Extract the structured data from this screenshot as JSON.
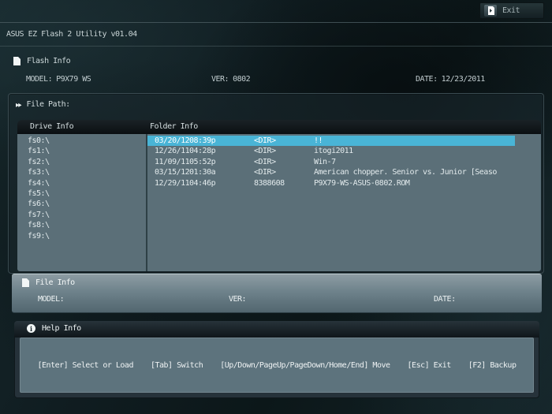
{
  "app": {
    "title": "ASUS EZ Flash 2 Utility v01.04",
    "exit_label": "Exit"
  },
  "flash_info": {
    "title": "Flash Info",
    "model_label": "MODEL:",
    "model_value": "P9X79 WS",
    "ver_label": "VER:",
    "ver_value": "0802",
    "date_label": "DATE:",
    "date_value": "12/23/2011"
  },
  "file_path": {
    "title": "File Path:",
    "drive_header": "Drive Info",
    "folder_header": "Folder Info",
    "drives": [
      "fs0:\\",
      "fs1:\\",
      "fs2:\\",
      "fs3:\\",
      "fs4:\\",
      "fs5:\\",
      "fs6:\\",
      "fs7:\\",
      "fs8:\\",
      "fs9:\\"
    ],
    "folders": [
      {
        "date": "03/20/12",
        "time": "08:39p",
        "size": "<DIR>",
        "name": "!!",
        "selected": true
      },
      {
        "date": "12/26/11",
        "time": "04:28p",
        "size": "<DIR>",
        "name": "itogi2011",
        "selected": false
      },
      {
        "date": "11/09/11",
        "time": "05:52p",
        "size": "<DIR>",
        "name": "Win-7",
        "selected": false
      },
      {
        "date": "03/15/12",
        "time": "01:30a",
        "size": "<DIR>",
        "name": "American chopper. Senior vs. Junior [Seaso",
        "selected": false
      },
      {
        "date": "12/29/11",
        "time": "04:46p",
        "size": "8388608",
        "name": "P9X79-WS-ASUS-0802.ROM",
        "selected": false
      }
    ]
  },
  "file_info": {
    "title": "File Info",
    "model_label": "MODEL:",
    "ver_label": "VER:",
    "date_label": "DATE:"
  },
  "help_info": {
    "title": "Help Info",
    "items": [
      "[Enter] Select or Load",
      "[Tab] Switch",
      "[Up/Down/PageUp/PageDown/Home/End] Move",
      "[Esc] Exit",
      "[F2] Backup"
    ]
  },
  "colors": {
    "selection_highlight": "#49b4d6",
    "table_body": "#5b6f78",
    "table_header_bg": "#10161a",
    "background_base": "#101d21"
  }
}
